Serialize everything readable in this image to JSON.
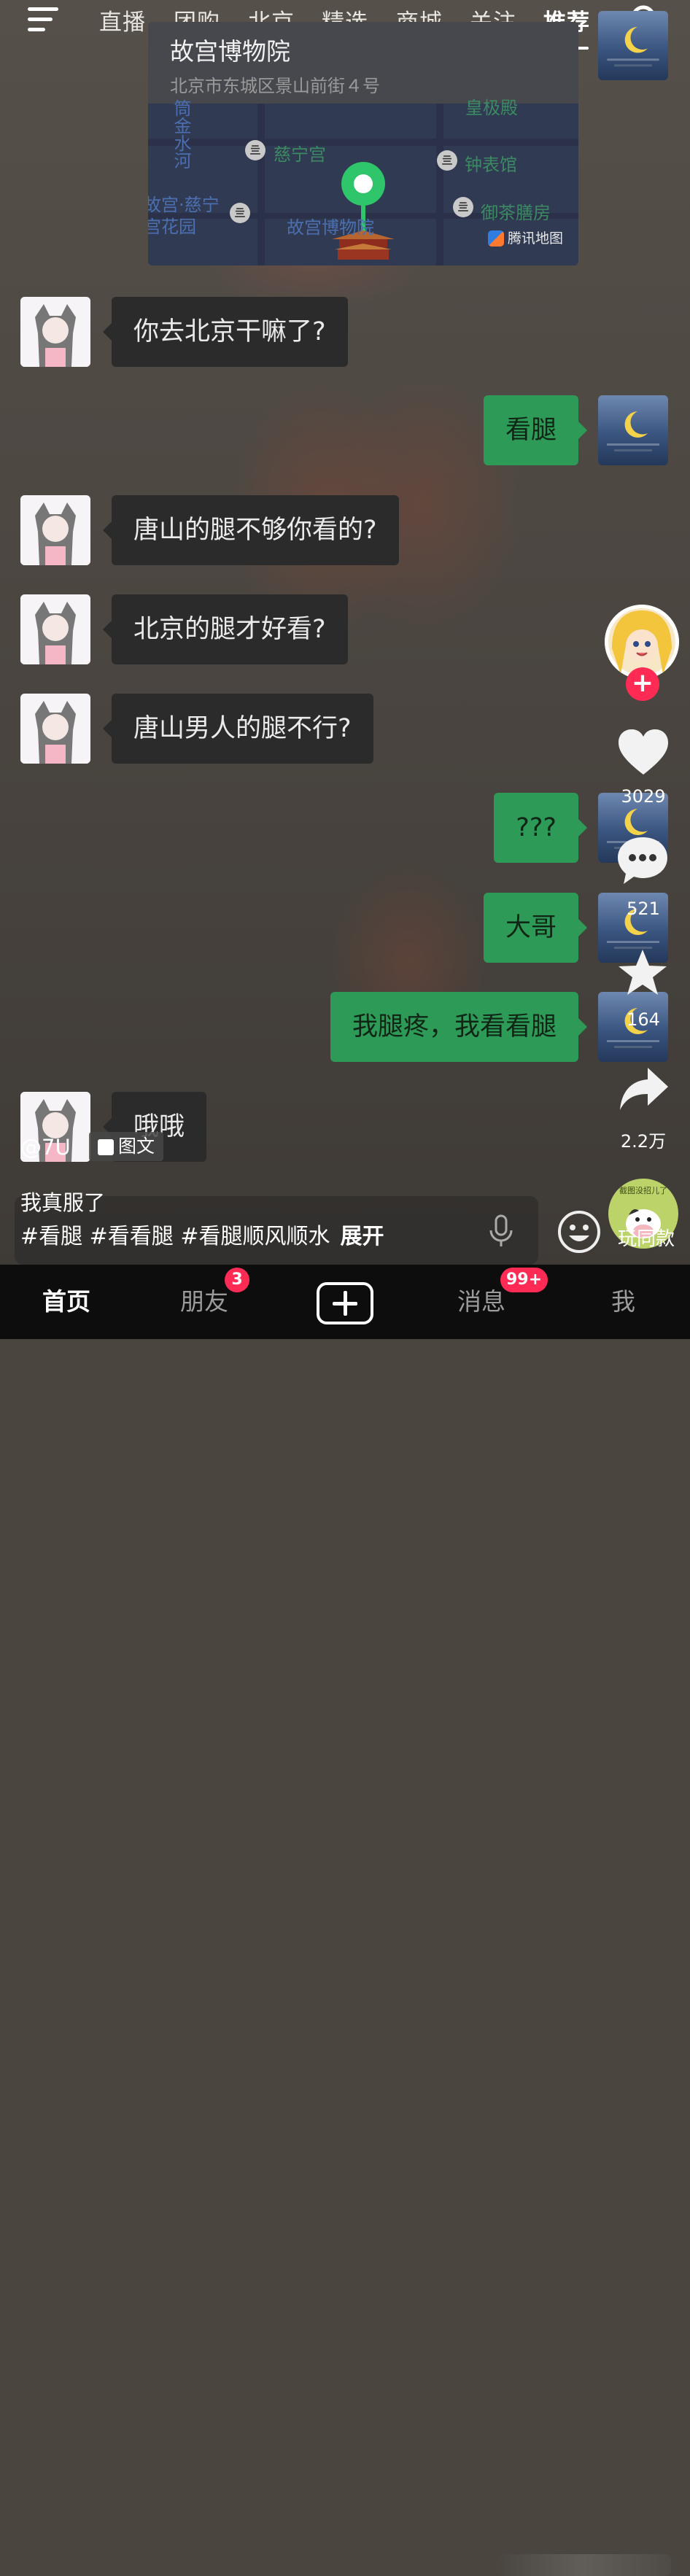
{
  "nav": {
    "tabs": [
      "直播",
      "团购",
      "北京",
      "精选",
      "商城",
      "关注",
      "推荐"
    ],
    "active_tab": "推荐"
  },
  "map": {
    "title": "故宫博物院",
    "address": "北京市东城区景山前街４号",
    "labels": {
      "river": "筒金水河",
      "cining": "慈宁宫",
      "clock": "钟表馆",
      "garden": "故宫·慈宁宫花园",
      "tea": "御茶膳房",
      "museum": "故宫博物院",
      "top": "皇极殿"
    },
    "provider": "腾讯地图"
  },
  "chat": {
    "messages": [
      {
        "side": "left",
        "text": "你去北京干嘛了?"
      },
      {
        "side": "right",
        "text": "看腿"
      },
      {
        "side": "left",
        "text": "唐山的腿不够你看的?"
      },
      {
        "side": "left",
        "text": "北京的腿才好看?"
      },
      {
        "side": "left",
        "text": "唐山男人的腿不行?"
      },
      {
        "side": "right",
        "text": "???"
      },
      {
        "side": "right",
        "text": "大哥"
      },
      {
        "side": "right",
        "text": "我腿疼，我看看腿"
      },
      {
        "side": "left",
        "text": "哦哦"
      }
    ]
  },
  "rail": {
    "likes": "3029",
    "comments": "521",
    "favorites": "164",
    "shares": "2.2万"
  },
  "post": {
    "author": "@7U",
    "type_badge": "图文",
    "caption": "我真服了",
    "hashtags": "#看腿 #看看腿 #看腿顺风顺水",
    "expand": "展开",
    "same_style": "玩同款",
    "same_style_small": "截图没招儿了"
  },
  "tabbar": {
    "home": "首页",
    "friends": "朋友",
    "friends_badge": "3",
    "messages": "消息",
    "messages_badge": "99+",
    "me": "我"
  },
  "colors": {
    "accent_green": "#2e9a58",
    "badge_red": "#ff2b55",
    "map_pin": "#2fc56a"
  }
}
